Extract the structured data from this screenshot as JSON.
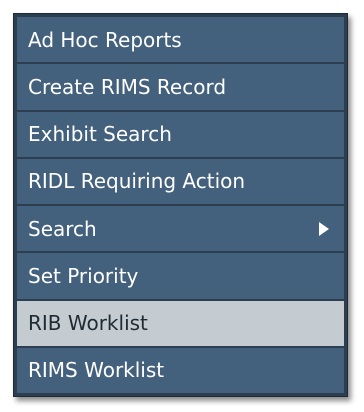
{
  "menu": {
    "items": [
      {
        "label": "Ad Hoc Reports",
        "has_submenu": false,
        "highlighted": false
      },
      {
        "label": "Create RIMS Record",
        "has_submenu": false,
        "highlighted": false
      },
      {
        "label": "Exhibit Search",
        "has_submenu": false,
        "highlighted": false
      },
      {
        "label": "RIDL Requiring Action",
        "has_submenu": false,
        "highlighted": false
      },
      {
        "label": "Search",
        "has_submenu": true,
        "highlighted": false,
        "icon": "chevron-right-icon"
      },
      {
        "label": "Set Priority",
        "has_submenu": false,
        "highlighted": false
      },
      {
        "label": "RIB Worklist",
        "has_submenu": false,
        "highlighted": true
      },
      {
        "label": "RIMS Worklist",
        "has_submenu": false,
        "highlighted": false
      }
    ]
  },
  "colors": {
    "menu_background": "#2d3e50",
    "item_background": "#43607d",
    "item_highlight": "#c4ccd2",
    "text": "#ffffff",
    "text_highlight": "#1f2a33"
  }
}
